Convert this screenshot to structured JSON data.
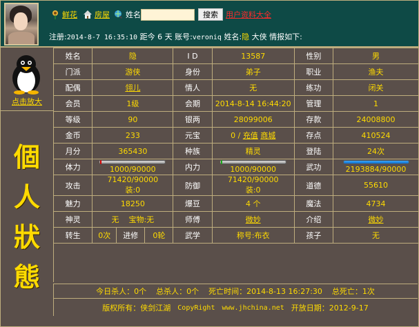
{
  "header": {
    "links": [
      {
        "icon": "flower-icon",
        "label": "鲜花"
      },
      {
        "icon": "house-icon",
        "label": "房屋"
      }
    ],
    "name_label": "姓名",
    "name_input_value": "",
    "search_button": "搜索",
    "all_users_link": "用户资料大全",
    "info_line": {
      "prefix": "注册:",
      "reg_time": "2014-8-7 16:35:10",
      "since_label": "距今",
      "days": "6",
      "days_unit": "天",
      "account_label": "账号:",
      "account": "veroniq",
      "name_label": "姓名:",
      "name": "隐",
      "suffix": "大侠 情报如下:"
    }
  },
  "left": {
    "zoom_link": "点击放大",
    "title_chars": [
      "個",
      "人",
      "狀",
      "態"
    ]
  },
  "profile": {
    "rows": [
      [
        {
          "label": "姓名",
          "value": "隐"
        },
        {
          "label": "I D",
          "value": "13587"
        },
        {
          "label": "性别",
          "value": "男"
        }
      ],
      [
        {
          "label": "门派",
          "value": "游侠"
        },
        {
          "label": "身份",
          "value": "弟子"
        },
        {
          "label": "职业",
          "value": "渔夫"
        }
      ],
      [
        {
          "label": "配偶",
          "value": "翎儿",
          "link": true
        },
        {
          "label": "情人",
          "value": "无"
        },
        {
          "label": "练功",
          "value": "闭关"
        }
      ],
      [
        {
          "label": "会员",
          "value": "1级"
        },
        {
          "label": "会期",
          "value": "2014-8-14 16:44:20"
        },
        {
          "label": "管理",
          "value": "1"
        }
      ],
      [
        {
          "label": "等级",
          "value": "90"
        },
        {
          "label": "银两",
          "value": "28099006"
        },
        {
          "label": "存款",
          "value": "24008800"
        }
      ],
      [
        {
          "label": "金币",
          "value": "233"
        },
        {
          "label": "元宝",
          "value": "0",
          "extra": [
            "充值",
            "商城"
          ]
        },
        {
          "label": "存点",
          "value": "410524"
        }
      ],
      [
        {
          "label": "月分",
          "value": "365430"
        },
        {
          "label": "种族",
          "value": "精灵"
        },
        {
          "label": "登陆",
          "value": "24次"
        }
      ]
    ],
    "bars": {
      "hp": {
        "label": "体力",
        "value": "1000/90000",
        "fraction": 0.011
      },
      "mp": {
        "label": "内力",
        "value": "1000/90000",
        "fraction": 0.011
      },
      "skill": {
        "label": "武功",
        "value": "2193884/90000",
        "fraction": 1.0
      }
    },
    "attack": {
      "label": "攻击",
      "value": "71420/90000",
      "equip": "装:0"
    },
    "defense": {
      "label": "防御",
      "value": "71420/90000",
      "equip": "装:0"
    },
    "morality": {
      "label": "道德",
      "value": "55610"
    },
    "row_charm": [
      {
        "label": "魅力",
        "value": "18250"
      },
      {
        "label": "爆豆",
        "value": "4 个"
      },
      {
        "label": "魔法",
        "value": "4734"
      }
    ],
    "row_spirit": {
      "label": "神灵",
      "spirit": "无",
      "treasure": "宝物:无",
      "master_label": "师傅",
      "master": "微妙",
      "intro_label": "介绍",
      "intro": "微妙"
    },
    "row_reborn": {
      "label": "转生",
      "reborn": "0次",
      "advance_label": "进修",
      "advance": "0轮",
      "skill_label": "武学",
      "title": "称号:布衣",
      "child_label": "孩子",
      "child": "无"
    }
  },
  "footer": {
    "today_kills": "今日杀人：0个",
    "total_kills": "总杀人：0个",
    "death_time": "死亡时间：2014-8-13 16:27:30",
    "total_deaths": "总死亡：1次",
    "copyright_label": "版权所有：侠剑江湖",
    "copyright_right": "CopyRight",
    "site": "www.jhchina.net",
    "open_date": "开放日期：2012-9-17"
  },
  "colors": {
    "accent": "#ffdb00",
    "panel": "#5a4f4a",
    "header": "#0e4a46",
    "link_red": "#ff2b2b"
  }
}
